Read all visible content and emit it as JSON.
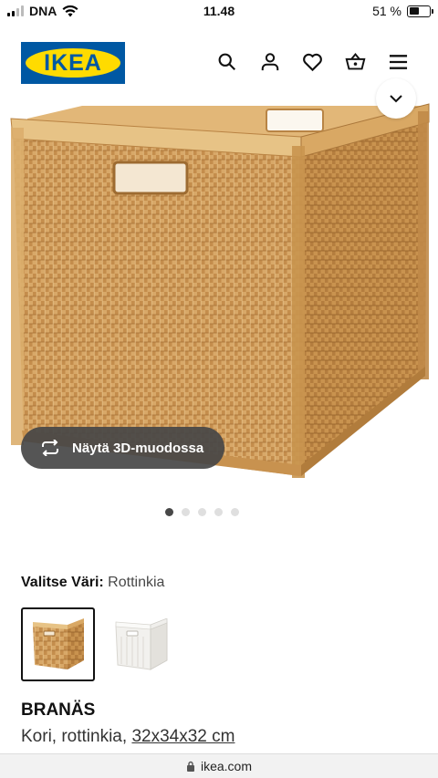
{
  "status_bar": {
    "carrier": "DNA",
    "time": "11.48",
    "battery_percent": "51 %",
    "battery_level": 0.51
  },
  "header": {
    "logo_text": "IKEA",
    "icons": [
      "search-icon",
      "user-icon",
      "heart-icon",
      "basket-icon",
      "menu-icon"
    ],
    "brand_blue": "#0058a3",
    "brand_yellow": "#ffdb00"
  },
  "gallery": {
    "view_3d_label": "Näytä 3D-muodossa",
    "image_count": 5,
    "active_index": 0
  },
  "color_picker": {
    "label": "Valitse Väri:",
    "selected_value": "Rottinkia",
    "swatches": [
      {
        "name": "rattan",
        "selected": true
      },
      {
        "name": "white",
        "selected": false
      }
    ]
  },
  "product": {
    "name": "BRANÄS",
    "description": "Kori, rottinkia,",
    "size": "32x34x32 cm"
  },
  "browser": {
    "domain": "ikea.com"
  }
}
